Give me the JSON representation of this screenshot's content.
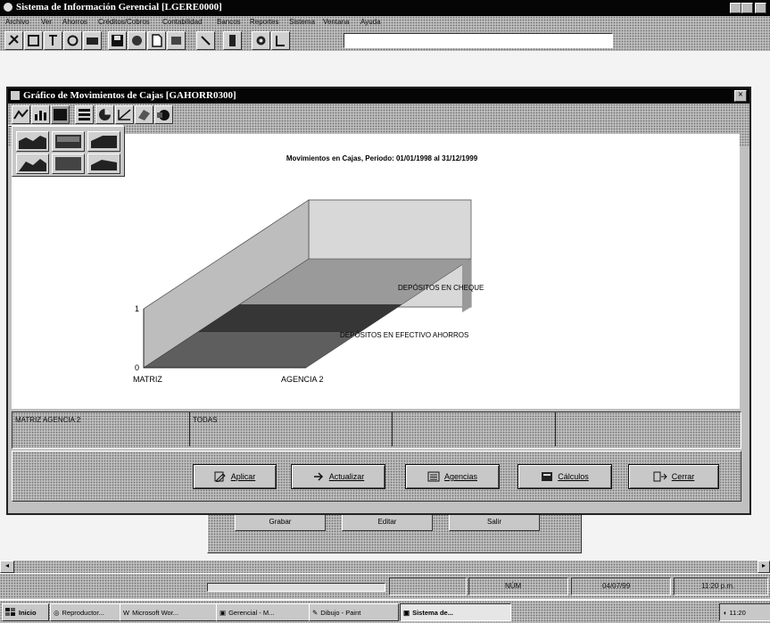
{
  "app": {
    "title": "Sistema de Información Gerencial [LGERE0000]",
    "menu": [
      "Archivo",
      "Ver",
      "Ahorros",
      "Créditos/Cobros",
      "Contabilidad",
      "Bancos",
      "Reportes",
      "Sistema",
      "Ventana",
      "Ayuda"
    ]
  },
  "window": {
    "title": "Gráfico de Movimientos de Cajas [GAHORR0300]",
    "close_glyph": "×"
  },
  "chart_data": {
    "type": "area",
    "title": "Movimientos en Cajas, Periodo: 01/01/1998 al 31/12/1999",
    "categories": [
      "MATRIZ",
      "AGENCIA 2"
    ],
    "y_ticks": [
      "0",
      "1"
    ],
    "ylim": [
      0,
      1
    ],
    "series": [
      {
        "name": "DEPÓSITOS EN EFECTIVO AHORROS"
      },
      {
        "name": "DEPÓSITOS EN CHEQUE"
      }
    ],
    "colors": [
      "#5e5e5e",
      "#363636",
      "#9a9a9a",
      "#c8c8c8"
    ]
  },
  "grid": {
    "row1": [
      "MATRIZ AGENCIA 2",
      "TODAS",
      "",
      ""
    ]
  },
  "buttons": [
    {
      "label": "Aplicar",
      "icon": "pencil-icon"
    },
    {
      "label": "Actualizar",
      "icon": "refresh-icon"
    },
    {
      "label": "Agencias",
      "icon": "list-icon"
    },
    {
      "label": "Cálculos",
      "icon": "calculator-icon"
    },
    {
      "label": "Cerrar",
      "icon": "door-icon"
    }
  ],
  "background_buttons": [
    "Grabar",
    "Editar",
    "Salir"
  ],
  "status": {
    "num": "NÚM",
    "date": "04/07/99",
    "time": "11:20 p.m."
  },
  "taskbar": {
    "start": "Inicio",
    "tasks": [
      "Reproductor...",
      "Microsoft Wor...",
      "Gerencial - M...",
      "Dibujo - Paint",
      "Sistema de..."
    ],
    "clock": "11:20"
  }
}
